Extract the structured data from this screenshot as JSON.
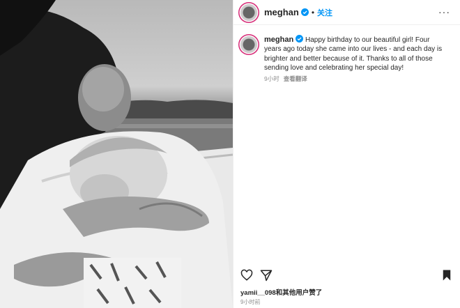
{
  "post": {
    "username": "meghan",
    "separator": "•",
    "follow_label": "关注",
    "more_label": "···",
    "caption_text": "Happy birthday to our beautiful girl! Four years ago today she came into our lives - and each day is brighter and better because of it. Thanks to all of those sending love and celebrating her special day!",
    "caption_age": "9小时",
    "translate_label": "查看翻译",
    "likes_user": "yamii__098",
    "likes_suffix": "和其他用户赞了",
    "post_age": "9小时前"
  },
  "icons": {
    "verified": "verified-badge-icon",
    "more": "more-options-icon",
    "like": "heart-icon",
    "share": "paper-plane-icon",
    "save": "bookmark-icon"
  },
  "colors": {
    "accent_blue": "#0095f6",
    "text": "#262626",
    "muted": "#8e8e8e",
    "avatar_ring": "#d62976"
  }
}
